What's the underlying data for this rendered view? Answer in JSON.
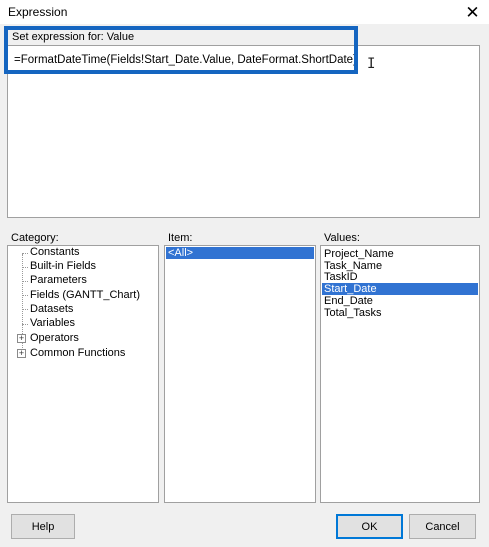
{
  "window": {
    "title": "Expression",
    "close_glyph": "✕"
  },
  "expression": {
    "label": "Set expression for: Value",
    "text": "=FormatDateTime(Fields!Start_Date.Value, DateFormat.ShortDate)"
  },
  "category": {
    "label": "Category:",
    "items": [
      {
        "label": "Constants",
        "expandable": false
      },
      {
        "label": "Built-in Fields",
        "expandable": false
      },
      {
        "label": "Parameters",
        "expandable": false
      },
      {
        "label": "Fields (GANTT_Chart)",
        "expandable": false
      },
      {
        "label": "Datasets",
        "expandable": false
      },
      {
        "label": "Variables",
        "expandable": false
      },
      {
        "label": "Operators",
        "expandable": true
      },
      {
        "label": "Common Functions",
        "expandable": true
      }
    ]
  },
  "item": {
    "label": "Item:",
    "items": [
      "<All>"
    ],
    "selected": "<All>"
  },
  "values": {
    "label": "Values:",
    "items": [
      "Project_Name",
      "Task_Name",
      "TaskID",
      "Start_Date",
      "End_Date",
      "Total_Tasks"
    ],
    "selected": "Start_Date"
  },
  "buttons": {
    "help": "Help",
    "ok": "OK",
    "cancel": "Cancel"
  },
  "colors": {
    "highlight_border": "#1565c0",
    "selection": "#3173d2"
  }
}
